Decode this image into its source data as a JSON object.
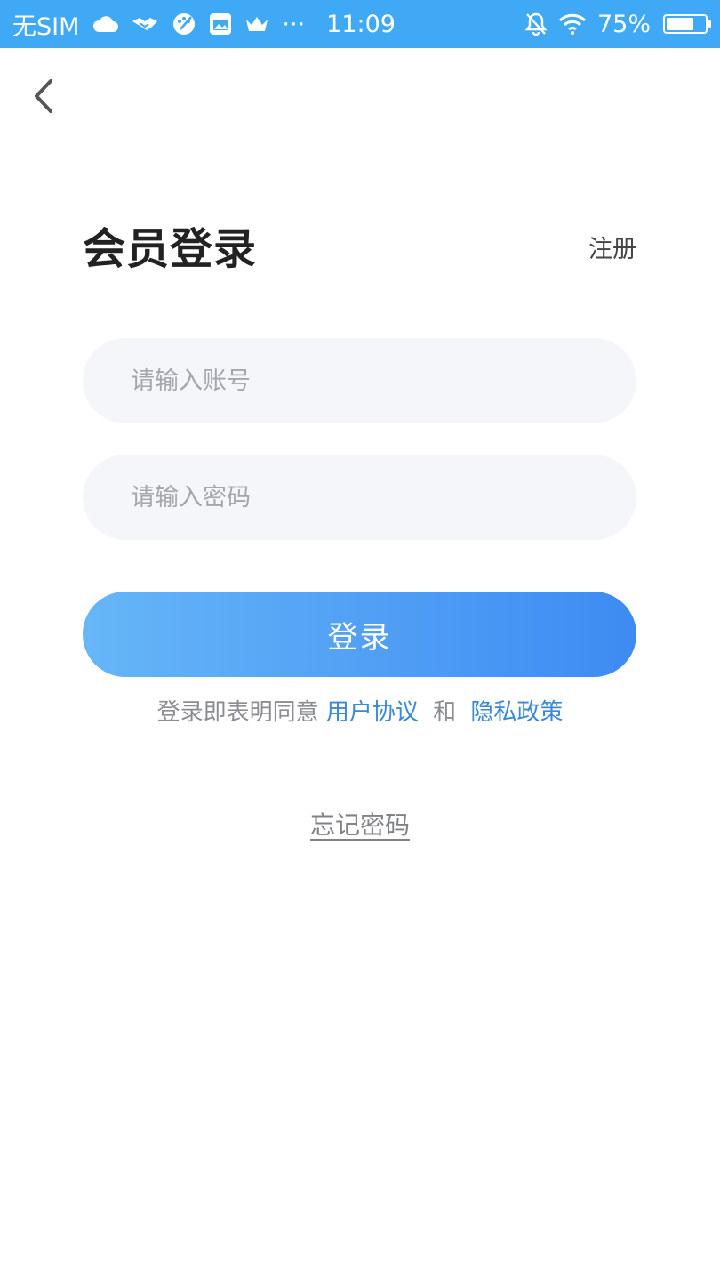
{
  "status_bar": {
    "carrier": "无SIM",
    "time": "11:09",
    "more": "···",
    "battery": "75%",
    "battery_level": 0.75,
    "icons": [
      "cloud-icon",
      "handshake-icon",
      "palette-icon",
      "gallery-icon",
      "crown-icon",
      "bell-off-icon",
      "wifi-icon",
      "battery-icon"
    ],
    "color": "#3FA9F5"
  },
  "nav": {
    "back_icon": "chevron-left-icon"
  },
  "header": {
    "title": "会员登录",
    "register_label": "注册"
  },
  "form": {
    "account_placeholder": "请输入账号",
    "account_value": "",
    "password_placeholder": "请输入密码",
    "password_value": "",
    "login_label": "登录",
    "login_gradient": [
      "#66B6F8",
      "#3D8BF2"
    ]
  },
  "agreement": {
    "prefix": "登录即表明同意",
    "user_agreement": "用户协议",
    "and": "和",
    "privacy_policy": "隐私政策",
    "link_color": "#3A89D9"
  },
  "forgot": {
    "label": "忘记密码"
  }
}
